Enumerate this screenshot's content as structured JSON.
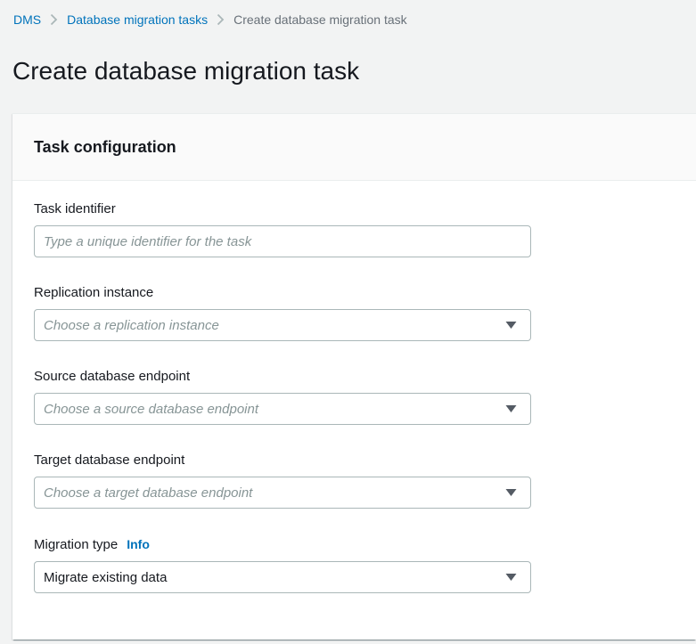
{
  "breadcrumb": {
    "items": [
      {
        "label": "DMS"
      },
      {
        "label": "Database migration tasks"
      },
      {
        "label": "Create database migration task"
      }
    ]
  },
  "page": {
    "title": "Create database migration task"
  },
  "panel": {
    "title": "Task configuration",
    "fields": [
      {
        "label": "Task identifier",
        "control": "text-input",
        "placeholder": "Type a unique identifier for the task"
      },
      {
        "label": "Replication instance",
        "control": "dropdown",
        "placeholder": "Choose a replication instance"
      },
      {
        "label": "Source database endpoint",
        "control": "dropdown",
        "placeholder": "Choose a source database endpoint"
      },
      {
        "label": "Target database endpoint",
        "control": "dropdown",
        "placeholder": "Choose a target database endpoint"
      },
      {
        "label": "Migration type",
        "info_label": "Info",
        "control": "dropdown",
        "value": "Migrate existing data"
      }
    ]
  },
  "icons": {
    "breadcrumb_separator": "chevron-right-icon",
    "dropdown_caret": "caret-down-icon"
  },
  "colors": {
    "link_blue": "#0073bb",
    "page_background": "#f2f3f3",
    "panel_background": "#ffffff",
    "panel_header_background": "#fafafa",
    "input_border": "#aab7b8",
    "placeholder_text": "#879596",
    "primary_text": "#16191f",
    "breadcrumb_current": "#687078",
    "caret": "#545b64"
  }
}
